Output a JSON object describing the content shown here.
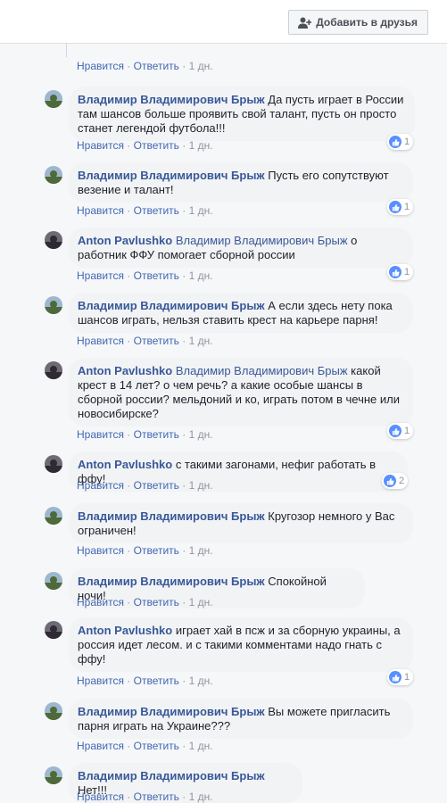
{
  "header": {
    "add_friend_label": "Добавить в друзья"
  },
  "actions": {
    "like": "Нравится",
    "reply": "Ответить",
    "sep": " · ",
    "time": "1 дн."
  },
  "comments": [
    {
      "author": "Владимир Владимирович Брыж",
      "mention": "",
      "text": "Да пусть играет в России там шансов больше проявить свой талант, пусть он просто станет легендой футбола!!!",
      "likes": "1"
    },
    {
      "author": "Владимир Владимирович Брыж",
      "mention": "",
      "text": "Пусть его сопутствуют везение и талант!",
      "likes": "1"
    },
    {
      "author": "Anton Pavlushko",
      "mention": "Владимир Владимирович Брыж",
      "text": "о работник ФФУ помогает сборной россии",
      "likes": "1"
    },
    {
      "author": "Владимир Владимирович Брыж",
      "mention": "",
      "text": "А если здесь нету пока шансов играть, нельзя ставить крест на карьере парня!",
      "likes": ""
    },
    {
      "author": "Anton Pavlushko",
      "mention": "Владимир Владимирович Брыж",
      "text": "какой крест в 14 лет? о чем речь? а какие особые шансы в сборной россии? мельдоний и ко, играть потом в чечне или новосибирске?",
      "likes": "1"
    },
    {
      "author": "Anton Pavlushko",
      "mention": "",
      "text": "с такими загонами, нефиг работать в ффу!",
      "likes": "2"
    },
    {
      "author": "Владимир Владимирович Брыж",
      "mention": "",
      "text": "Кругозор немного у Вас ограничен!",
      "likes": ""
    },
    {
      "author": "Владимир Владимирович Брыж",
      "mention": "",
      "text": "Спокойной ночи!",
      "likes": ""
    },
    {
      "author": "Anton Pavlushko",
      "mention": "",
      "text": "играет хай в псж и за сборную украины, а россия идет лесом. и с такими комментами надо гнать с ффу!",
      "likes": "1"
    },
    {
      "author": "Владимир Владимирович Брыж",
      "mention": "",
      "text": "Вы можете пригласить парня играть на Украине???",
      "likes": ""
    },
    {
      "author": "Владимир Владимирович Брыж",
      "mention": "",
      "text": "Нет!!!",
      "likes": ""
    }
  ]
}
